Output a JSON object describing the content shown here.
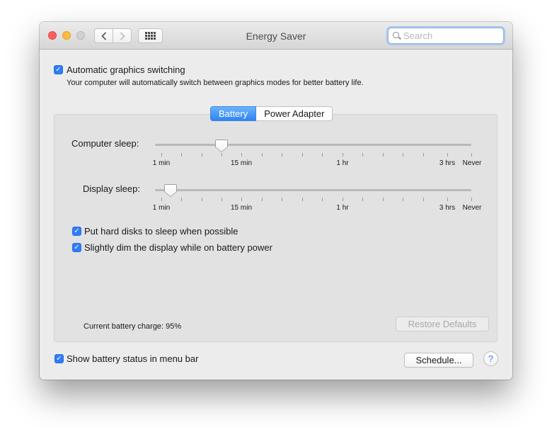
{
  "window": {
    "title": "Energy Saver",
    "search_placeholder": "Search"
  },
  "toolbar": {
    "back_icon": "chevron-left-icon",
    "forward_icon": "chevron-right-icon",
    "show_all_icon": "grid-icon"
  },
  "graphics": {
    "label": "Automatic graphics switching",
    "description": "Your computer will automatically switch between graphics modes for better battery life.",
    "checked": true
  },
  "tabs": [
    {
      "label": "Battery",
      "selected": true
    },
    {
      "label": "Power Adapter",
      "selected": false
    }
  ],
  "computer_sleep": {
    "label": "Computer sleep:",
    "value": "10 min",
    "ticks": [
      "1 min",
      "15 min",
      "1 hr",
      "3 hrs",
      "Never"
    ]
  },
  "display_sleep": {
    "label": "Display sleep:",
    "value": "2 min",
    "ticks": [
      "1 min",
      "15 min",
      "1 hr",
      "3 hrs",
      "Never"
    ]
  },
  "options": {
    "hard_disks": {
      "label": "Put hard disks to sleep when possible",
      "checked": true
    },
    "dim_display": {
      "label": "Slightly dim the display while on battery power",
      "checked": true
    }
  },
  "battery_charge": "Current battery charge: 95%",
  "buttons": {
    "restore_defaults": "Restore Defaults",
    "schedule": "Schedule...",
    "help": "?"
  },
  "menu_bar_status": {
    "label": "Show battery status in menu bar",
    "checked": true
  },
  "colors": {
    "accent": "#2f7cf6",
    "window_bg": "#ececec"
  }
}
